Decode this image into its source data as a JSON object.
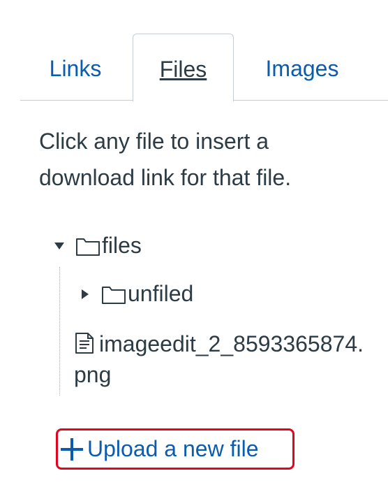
{
  "tabs": [
    {
      "label": "Links"
    },
    {
      "label": "Files"
    },
    {
      "label": "Images"
    }
  ],
  "instructions": "Click any file to insert a download link for that file.",
  "tree": {
    "root": {
      "name": "files"
    },
    "child_folder": {
      "name": "unfiled"
    },
    "file": {
      "name": "imageedit_2_8593365874.png"
    }
  },
  "upload": {
    "label": "Upload a new file"
  },
  "colors": {
    "link": "#0b5cad",
    "text": "#2d3b45",
    "highlight": "#e0061f",
    "border": "#c7cdd1"
  }
}
